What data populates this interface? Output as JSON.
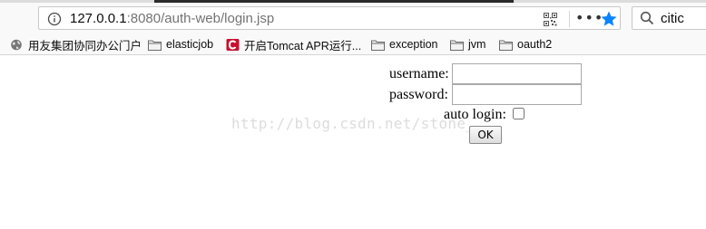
{
  "browser": {
    "url_host": "127.0.0.1",
    "url_rest": ":8080/auth-web/login.jsp",
    "search_value": "citic",
    "menu_glyph": "•••",
    "accent_color": "#0a84ff"
  },
  "bookmarks": [
    {
      "label": "用友集团协同办公门户",
      "icon": "globe-icon"
    },
    {
      "label": "elasticjob",
      "icon": "folder-icon"
    },
    {
      "label": "开启Tomcat APR运行...",
      "icon": "site-favicon"
    },
    {
      "label": "exception",
      "icon": "folder-icon"
    },
    {
      "label": "jvm",
      "icon": "folder-icon"
    },
    {
      "label": "oauth2",
      "icon": "folder-icon"
    }
  ],
  "form": {
    "username_label": "username:",
    "username_value": "",
    "password_label": "password:",
    "password_value": "",
    "auto_login_label": "auto login:",
    "ok_label": "OK"
  },
  "watermark": "http://blog.csdn.net/stone_"
}
